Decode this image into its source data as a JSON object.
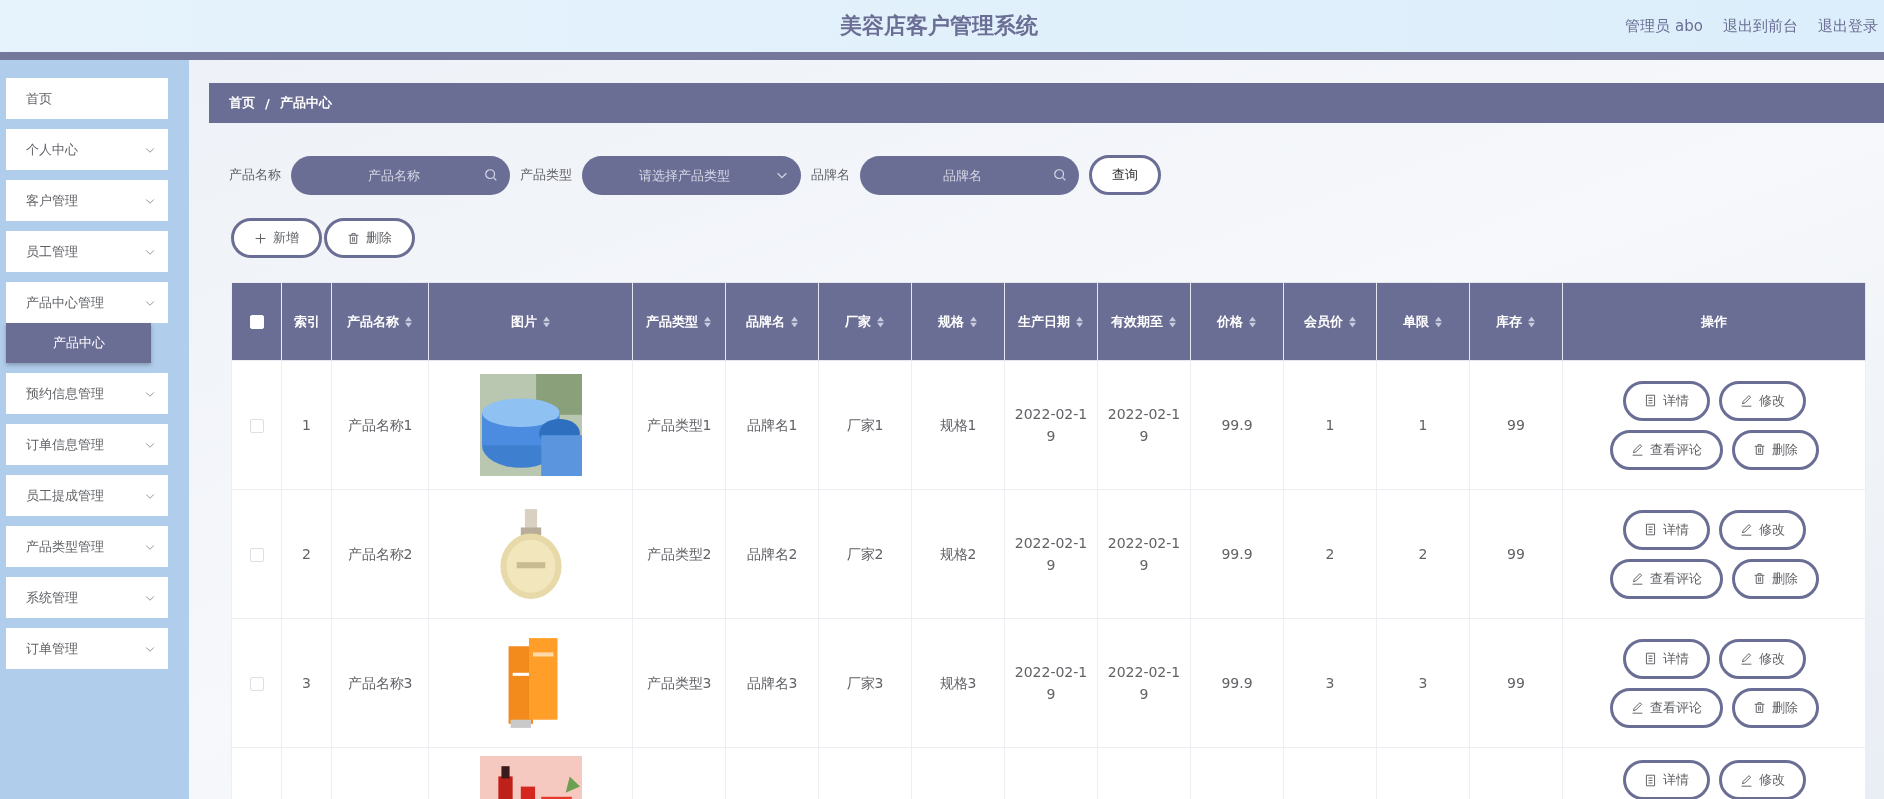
{
  "header": {
    "title": "美容店客户管理系统",
    "links": [
      "管理员 abo",
      "退出到前台",
      "退出登录"
    ]
  },
  "sidebar": {
    "items": [
      {
        "label": "首页",
        "kind": "link"
      },
      {
        "label": "个人中心",
        "kind": "submenu"
      },
      {
        "label": "客户管理",
        "kind": "submenu"
      },
      {
        "label": "员工管理",
        "kind": "submenu"
      },
      {
        "label": "产品中心管理",
        "kind": "submenu",
        "children": [
          {
            "label": "产品中心",
            "selected": true
          }
        ]
      },
      {
        "label": "预约信息管理",
        "kind": "submenu"
      },
      {
        "label": "订单信息管理",
        "kind": "submenu"
      },
      {
        "label": "员工提成管理",
        "kind": "submenu"
      },
      {
        "label": "产品类型管理",
        "kind": "submenu"
      },
      {
        "label": "系统管理",
        "kind": "submenu"
      },
      {
        "label": "订单管理",
        "kind": "submenu"
      }
    ]
  },
  "breadcrumb": [
    "首页",
    "/",
    "产品中心"
  ],
  "filters": [
    {
      "label": "产品名称",
      "placeholder": "产品名称",
      "kind": "text"
    },
    {
      "label": "产品类型",
      "placeholder": "请选择产品类型",
      "kind": "select"
    },
    {
      "label": "品牌名",
      "placeholder": "品牌名",
      "kind": "text"
    }
  ],
  "search_button": "查询",
  "toolbar": [
    "新增",
    "删除"
  ],
  "table": {
    "select_all_checked": false,
    "columns": [
      {
        "label": "索引",
        "sortable": false
      },
      {
        "label": "产品名称",
        "sortable": true
      },
      {
        "label": "图片",
        "sortable": true
      },
      {
        "label": "产品类型",
        "sortable": true
      },
      {
        "label": "品牌名",
        "sortable": true
      },
      {
        "label": "厂家",
        "sortable": true
      },
      {
        "label": "规格",
        "sortable": true
      },
      {
        "label": "生产日期",
        "sortable": true
      },
      {
        "label": "有效期至",
        "sortable": true
      },
      {
        "label": "价格",
        "sortable": true
      },
      {
        "label": "会员价",
        "sortable": true
      },
      {
        "label": "单限",
        "sortable": true
      },
      {
        "label": "库存",
        "sortable": true
      },
      {
        "label": "操作",
        "sortable": false
      }
    ],
    "rows": [
      {
        "checked": false,
        "cells": [
          "1",
          "产品名称1",
          {
            "kind": "picture"
          },
          "产品类型1",
          "品牌名1",
          "厂家1",
          "规格1",
          "2022-02-19",
          "2022-02-19",
          "99.9",
          "1",
          "1",
          "99"
        ],
        "actions": [
          "详情",
          "修改",
          "查看评论",
          "删除"
        ]
      },
      {
        "checked": false,
        "cells": [
          "2",
          "产品名称2",
          {
            "kind": "picture"
          },
          "产品类型2",
          "品牌名2",
          "厂家2",
          "规格2",
          "2022-02-19",
          "2022-02-19",
          "99.9",
          "2",
          "2",
          "99"
        ],
        "actions": [
          "详情",
          "修改",
          "查看评论",
          "删除"
        ]
      },
      {
        "checked": false,
        "cells": [
          "3",
          "产品名称3",
          {
            "kind": "picture"
          },
          "产品类型3",
          "品牌名3",
          "厂家3",
          "规格3",
          "2022-02-19",
          "2022-02-19",
          "99.9",
          "3",
          "3",
          "99"
        ],
        "actions": [
          "详情",
          "修改",
          "查看评论",
          "删除"
        ]
      },
      {
        "cells": [
          null,
          null,
          {
            "kind": "picture"
          },
          null,
          null,
          null,
          null,
          null,
          null,
          null,
          null,
          null,
          null
        ],
        "actions": [
          "详情",
          "修改"
        ]
      }
    ]
  }
}
